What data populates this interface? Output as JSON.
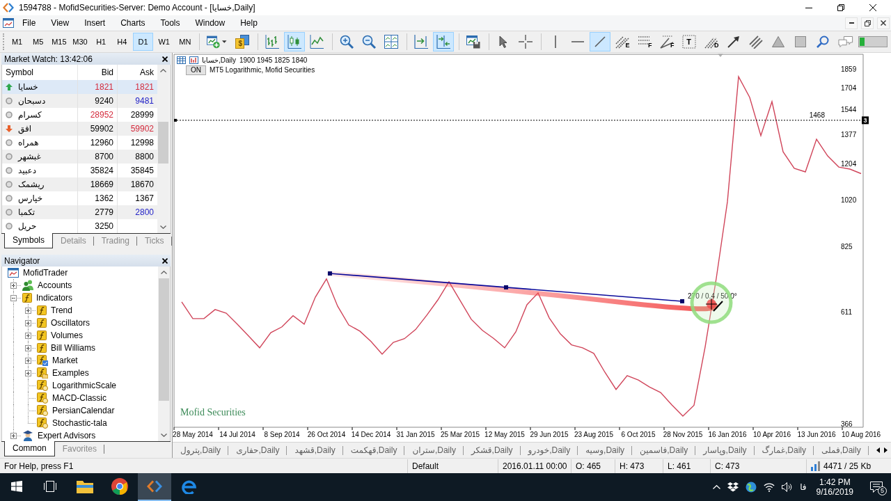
{
  "window": {
    "title": "1594788 - MofidSecurities-Server: Demo Account - [خسایا,Daily]"
  },
  "menu": [
    "File",
    "View",
    "Insert",
    "Charts",
    "Tools",
    "Window",
    "Help"
  ],
  "toolbar": {
    "timeframes": [
      {
        "label": "M1",
        "selected": false
      },
      {
        "label": "M5",
        "selected": false
      },
      {
        "label": "M15",
        "selected": false
      },
      {
        "label": "M30",
        "selected": false
      },
      {
        "label": "H1",
        "selected": false
      },
      {
        "label": "H4",
        "selected": false
      },
      {
        "label": "D1",
        "selected": true
      },
      {
        "label": "W1",
        "selected": false
      },
      {
        "label": "MN",
        "selected": false
      }
    ],
    "groups": [
      [
        {
          "kind": "newchart",
          "selected": false
        },
        {
          "kind": "market",
          "glyph": "$",
          "selected": false
        }
      ],
      [
        {
          "kind": "bars",
          "selected": false
        },
        {
          "kind": "candles",
          "selected": true
        },
        {
          "kind": "line",
          "selected": false
        }
      ],
      [
        {
          "kind": "zoomin",
          "selected": false
        },
        {
          "kind": "zoomout",
          "selected": false
        },
        {
          "kind": "tile",
          "selected": false
        }
      ],
      [
        {
          "kind": "autoscroll",
          "selected": false
        },
        {
          "kind": "shift",
          "selected": true
        }
      ],
      [
        {
          "kind": "template",
          "selected": false
        }
      ],
      [
        {
          "kind": "cursor",
          "selected": false
        },
        {
          "kind": "crosshair",
          "selected": false
        }
      ],
      [
        {
          "kind": "vline",
          "selected": false
        },
        {
          "kind": "hline",
          "selected": false
        },
        {
          "kind": "trendline",
          "selected": true
        },
        {
          "kind": "channel",
          "glyph": "E",
          "selected": false
        },
        {
          "kind": "fibo",
          "glyph": "F",
          "selected": false
        },
        {
          "kind": "fan",
          "glyph": "F",
          "selected": false
        },
        {
          "kind": "text",
          "glyph": "T",
          "selected": false
        },
        {
          "kind": "pitchfork",
          "glyph": "D",
          "selected": false
        },
        {
          "kind": "arrow",
          "selected": false
        },
        {
          "kind": "lines",
          "selected": false
        },
        {
          "kind": "triangle",
          "selected": false
        },
        {
          "kind": "rectangle",
          "selected": false
        },
        {
          "kind": "search",
          "selected": false
        },
        {
          "kind": "chat",
          "selected": false
        }
      ]
    ]
  },
  "market_watch": {
    "title": "Market Watch: 13:42:06",
    "columns": [
      "Symbol",
      "Bid",
      "Ask"
    ],
    "rows": [
      {
        "symbol": "خسایا",
        "rising": true,
        "falling": false,
        "bid": {
          "price": "1821",
          "color": "#d42a3c"
        },
        "ask": {
          "price": "1821",
          "color": "#d42a3c"
        },
        "selected": true
      },
      {
        "symbol": "دسبحان",
        "rising": false,
        "falling": false,
        "bid": {
          "price": "9240",
          "color": "#000000"
        },
        "ask": {
          "price": "9481",
          "color": "#2323c8"
        },
        "selected": false
      },
      {
        "symbol": "کسرام",
        "rising": false,
        "falling": false,
        "bid": {
          "price": "28952",
          "color": "#d42a3c"
        },
        "ask": {
          "price": "28999",
          "color": "#000000"
        },
        "selected": false
      },
      {
        "symbol": "افق",
        "rising": false,
        "falling": true,
        "bid": {
          "price": "59902",
          "color": "#000000"
        },
        "ask": {
          "price": "59902",
          "color": "#d42a3c"
        },
        "selected": false
      },
      {
        "symbol": "همراه",
        "rising": false,
        "falling": false,
        "bid": {
          "price": "12960",
          "color": "#000000"
        },
        "ask": {
          "price": "12998",
          "color": "#000000"
        },
        "selected": false
      },
      {
        "symbol": "غبشهر",
        "rising": false,
        "falling": false,
        "bid": {
          "price": "8700",
          "color": "#000000"
        },
        "ask": {
          "price": "8800",
          "color": "#000000"
        },
        "selected": false
      },
      {
        "symbol": "دعبید",
        "rising": false,
        "falling": false,
        "bid": {
          "price": "35824",
          "color": "#000000"
        },
        "ask": {
          "price": "35845",
          "color": "#000000"
        },
        "selected": false
      },
      {
        "symbol": "ریشمک",
        "rising": false,
        "falling": false,
        "bid": {
          "price": "18669",
          "color": "#000000"
        },
        "ask": {
          "price": "18670",
          "color": "#000000"
        },
        "selected": false
      },
      {
        "symbol": "خپارس",
        "rising": false,
        "falling": false,
        "bid": {
          "price": "1362",
          "color": "#000000"
        },
        "ask": {
          "price": "1367",
          "color": "#000000"
        },
        "selected": false
      },
      {
        "symbol": "تکمبا",
        "rising": false,
        "falling": false,
        "bid": {
          "price": "2779",
          "color": "#000000"
        },
        "ask": {
          "price": "2800",
          "color": "#2323c8"
        },
        "selected": false
      },
      {
        "symbol": "حریل",
        "rising": false,
        "falling": false,
        "bid": {
          "price": "3250",
          "color": "#000000"
        },
        "selected": false
      }
    ],
    "tabs": [
      {
        "label": "Symbols",
        "selected": true
      },
      {
        "label": "Details",
        "selected": false
      },
      {
        "label": "Trading",
        "selected": false
      },
      {
        "label": "Ticks",
        "selected": false
      }
    ]
  },
  "navigator": {
    "title": "Navigator",
    "tree": [
      {
        "label": "MofidTrader",
        "kind": "terminal",
        "children": [
          {
            "label": "Accounts",
            "kind": "accounts",
            "expanded": false
          },
          {
            "label": "Indicators",
            "kind": "folder",
            "expanded": true,
            "children": [
              {
                "label": "Trend",
                "kind": "folder",
                "expanded": false
              },
              {
                "label": "Oscillators",
                "kind": "folder",
                "expanded": false
              },
              {
                "label": "Volumes",
                "kind": "folder",
                "expanded": false
              },
              {
                "label": "Bill Williams",
                "kind": "folder",
                "expanded": false
              },
              {
                "label": "Market",
                "kind": "market",
                "expanded": false
              },
              {
                "label": "Examples",
                "kind": "examples",
                "expanded": false
              },
              {
                "label": "LogarithmicScale",
                "kind": "indicator"
              },
              {
                "label": "MACD-Classic",
                "kind": "indicator"
              },
              {
                "label": "PersianCalendar",
                "kind": "indicator"
              },
              {
                "label": "Stochastic-tala",
                "kind": "indicator"
              }
            ]
          },
          {
            "label": "Expert Advisors",
            "kind": "experts",
            "expanded": false
          }
        ]
      }
    ],
    "tabs": [
      {
        "label": "Common",
        "selected": true
      },
      {
        "label": "Favorites",
        "selected": false
      }
    ]
  },
  "chart": {
    "legend_prices": "1900 1945 1825 1840",
    "indicator": {
      "button": "ON",
      "label": "MT5 Logarithmic, Mofid Securities"
    },
    "broker_label": "Mofid Securities",
    "chart_data": {
      "type": "line",
      "log": "y",
      "categories": [
        null,
        null,
        "28 May 2014",
        null,
        null,
        null,
        "14 Jul 2014",
        null,
        null,
        null,
        "8 Sep 2014",
        null,
        null,
        null,
        "26 Oct 2014",
        null,
        null,
        null,
        "14 Dec 2014",
        null,
        null,
        null,
        "31 Jan 2015",
        null,
        null,
        null,
        "25 Mar 2015",
        null,
        null,
        null,
        "12 May 2015",
        null,
        null,
        null,
        "29 Jun 2015",
        null,
        null,
        null,
        "23 Aug 2015",
        null,
        null,
        null,
        "6 Oct 2015",
        null,
        null,
        null,
        "28 Nov 2015",
        null,
        null,
        null,
        "16 Jan 2016",
        null,
        null,
        null,
        "10 Apr 2016",
        null,
        null,
        null,
        "13 Jun 2016",
        null,
        null,
        null,
        "10 Aug 2016"
      ],
      "series": [
        {
          "name": "خسایا,Daily",
          "color": "#d0455a",
          "values": [
            null,
            639,
            592,
            592,
            617,
            607,
            577,
            547,
            518,
            555,
            570,
            600,
            577,
            653,
            710,
            627,
            575,
            559,
            533,
            503,
            531,
            540,
            563,
            601,
            645,
            701,
            643,
            590,
            561,
            541,
            518,
            557,
            631,
            666,
            594,
            552,
            525,
            518,
            505,
            463,
            428,
            456,
            447,
            433,
            422,
            399,
            379,
            398,
            520,
            712,
            1011,
            1793,
            1630,
            1368,
            1599,
            1271,
            1178,
            1159,
            1346,
            1247,
            1185,
            1174,
            1150
          ]
        }
      ],
      "ylim": [
        360,
        1986
      ],
      "yticks": [
        366,
        611,
        825,
        1020,
        1204,
        1377,
        1544,
        1704,
        1859
      ],
      "ref_lines": [
        {
          "axis": "y",
          "value": 1468,
          "label": "1468"
        }
      ]
    },
    "hline": {
      "tag": "3",
      "selected": true
    },
    "trendline": {
      "readout": "270 / 0.4 / 50.0°",
      "selected": true
    }
  },
  "chart_tabs": [
    {
      "label": "پترول,Daily",
      "selected": false
    },
    {
      "label": "حفاری,Daily",
      "selected": false
    },
    {
      "label": "قشهد,Daily",
      "selected": false
    },
    {
      "label": "قهکمت,Daily",
      "selected": false
    },
    {
      "label": "ستران,Daily",
      "selected": false
    },
    {
      "label": "قشکر,Daily",
      "selected": false
    },
    {
      "label": "خودرو,Daily",
      "selected": false
    },
    {
      "label": "وسیه,Daily",
      "selected": false
    },
    {
      "label": "فاسمین,Daily",
      "selected": false
    },
    {
      "label": "وپاسار,Daily",
      "selected": false
    },
    {
      "label": "غمارگ,Daily",
      "selected": false
    },
    {
      "label": "فملی,Daily",
      "selected": false
    }
  ],
  "status_bar": {
    "help": "For Help, press F1",
    "profile": "Default",
    "datetime": "2016.01.11 00:00",
    "open": "O: 465",
    "high": "H: 473",
    "low": "L: 461",
    "close": "C: 473",
    "traffic": "4471 / 25 Kb"
  },
  "taskbar": {
    "apps": [
      {
        "kind": "files",
        "selected": false
      },
      {
        "kind": "browser",
        "selected": false
      },
      {
        "kind": "terminal",
        "selected": true
      },
      {
        "kind": "web",
        "selected": false
      }
    ],
    "language": "فا",
    "time": "1:42 PM",
    "date": "9/16/2019",
    "notifications": "5"
  }
}
